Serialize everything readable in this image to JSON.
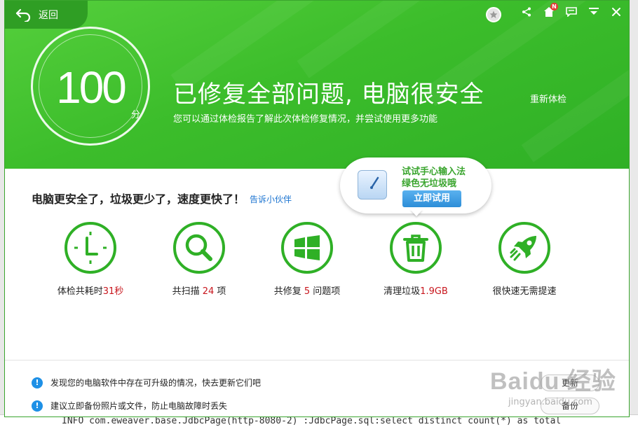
{
  "window": {
    "back_label": "返回",
    "recheck_label": "重新体检"
  },
  "score": {
    "value": "100",
    "unit": "分"
  },
  "headline": "已修复全部问题, 电脑很安全",
  "subline": "您可以通过体检报告了解此次体检修复情况，并尝试使用更多功能",
  "summary": {
    "text": "电脑更安全了，垃圾更少了，速度更快了！",
    "share_link": "告诉小伙伴"
  },
  "promo": {
    "line1": "试试手心输入法",
    "line2": "绿色无垃圾哦",
    "button": "立即试用"
  },
  "stats": [
    {
      "pre": "体检共耗时",
      "value": "31秒",
      "post": "",
      "icon": "clock-icon"
    },
    {
      "pre": "共扫描 ",
      "value": "24",
      "post": " 项",
      "icon": "magnifier-icon"
    },
    {
      "pre": "共修复 ",
      "value": "5",
      "post": " 问题项",
      "icon": "windows-logo-icon"
    },
    {
      "pre": "清理垃圾",
      "value": "1.9GB",
      "post": "",
      "icon": "trash-icon"
    },
    {
      "pre": "很快速无需提速",
      "value": "",
      "post": "",
      "icon": "rocket-icon"
    }
  ],
  "notices": [
    {
      "text": "发现您的电脑软件中存在可升级的情况，快去更新它们吧",
      "button": "更新"
    },
    {
      "text": "建议立即备份照片或文件，防止电脑故障时丢失",
      "button": "备份"
    }
  ],
  "watermark": {
    "brand": "Baidu 经验",
    "url": "jingyan.baidu.com"
  },
  "background": {
    "log_line": "INFO  com.eweaver.base.JdbcPage(http-8080-2) :JdbcPage.sql:select distinct count(*) as total"
  },
  "colors": {
    "green": "#3cbd2b",
    "highlight_red": "#c8161d",
    "link_blue": "#1a73d0",
    "info_blue": "#1e90e6"
  },
  "icons": {
    "top_bar": [
      "favorite-star-icon",
      "share-icon",
      "notification-icon",
      "message-icon",
      "menu-icon",
      "close-icon"
    ],
    "notification_badge": "N"
  }
}
